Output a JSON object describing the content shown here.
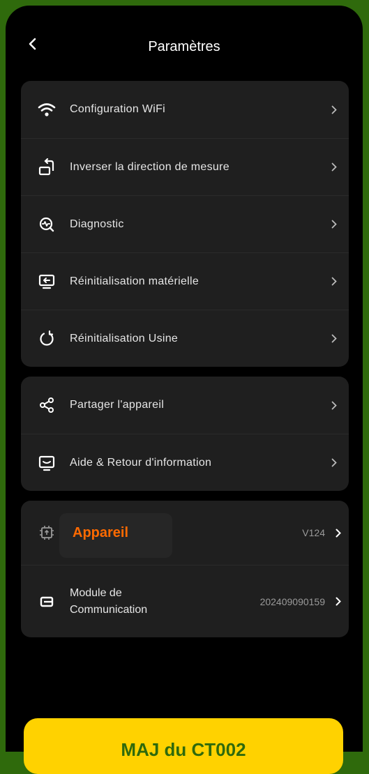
{
  "header": {
    "title": "Paramètres"
  },
  "group1": [
    {
      "label": "Configuration WiFi",
      "icon": "wifi-icon"
    },
    {
      "label": "Inverser la direction de mesure",
      "icon": "rotate-device-icon"
    },
    {
      "label": "Diagnostic",
      "icon": "diagnostic-icon"
    },
    {
      "label": "Réinitialisation matérielle",
      "icon": "hardware-reset-icon"
    },
    {
      "label": "Réinitialisation Usine",
      "icon": "refresh-icon"
    }
  ],
  "group2": [
    {
      "label": "Partager l'appareil",
      "icon": "share-icon"
    },
    {
      "label": "Aide & Retour d'information",
      "icon": "feedback-icon"
    }
  ],
  "group3": {
    "device": {
      "label": "Appareil",
      "value": "V124",
      "icon": "chip-icon",
      "accent": "#ff6a00"
    },
    "module": {
      "label_line1": "Module de",
      "label_line2": "Communication",
      "value": "202409090159",
      "icon": "module-icon"
    }
  },
  "cta": {
    "label": "MAJ du CT002"
  },
  "colors": {
    "frame": "#2f6a0c",
    "card": "#1f1f1f",
    "cta": "#ffd200"
  }
}
